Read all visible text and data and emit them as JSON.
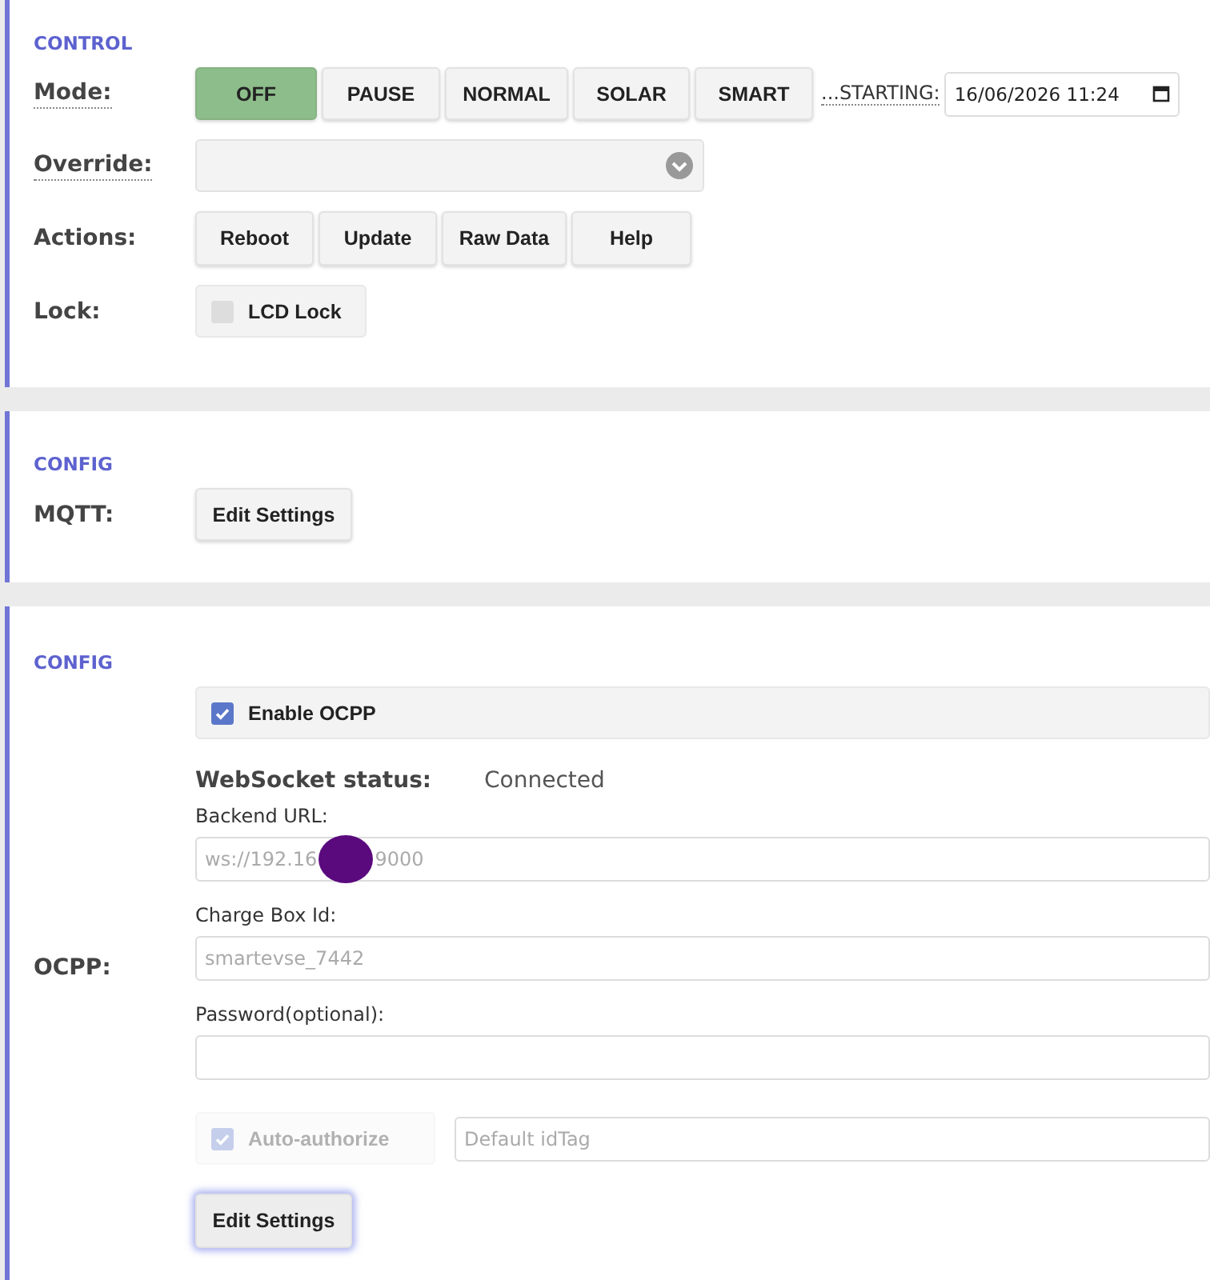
{
  "control": {
    "heading": "CONTROL",
    "mode": {
      "label": "Mode:",
      "buttons": [
        {
          "label": "OFF",
          "selected": true
        },
        {
          "label": "PAUSE",
          "selected": false
        },
        {
          "label": "NORMAL",
          "selected": false
        },
        {
          "label": "SOLAR",
          "selected": false
        },
        {
          "label": "SMART",
          "selected": false
        }
      ],
      "starting_label": "...STARTING:",
      "starting_value": "16/06/2026 11:24"
    },
    "override": {
      "label": "Override:"
    },
    "actions": {
      "label": "Actions:",
      "buttons": [
        "Reboot",
        "Update",
        "Raw Data",
        "Help"
      ]
    },
    "lock": {
      "label": "Lock:",
      "checkbox": {
        "label": "LCD Lock",
        "checked": false
      }
    }
  },
  "mqtt": {
    "heading": "CONFIG",
    "label": "MQTT:",
    "button": "Edit Settings"
  },
  "ocpp": {
    "heading": "CONFIG",
    "label": "OCPP:",
    "enable": {
      "label": "Enable OCPP",
      "checked": true
    },
    "status_label": "WebSocket status:",
    "status_value": "Connected",
    "backend_url": {
      "label": "Backend URL:",
      "value_start": "ws://192.16",
      "value_end": "9000",
      "redacted": true
    },
    "charge_box_id": {
      "label": "Charge Box Id:",
      "placeholder": "smartevse_7442"
    },
    "password": {
      "label": "Password(optional):"
    },
    "auto_authorize": {
      "label": "Auto-authorize",
      "checked": true,
      "disabled": true
    },
    "id_tag": {
      "placeholder": "Default idTag"
    },
    "button": {
      "label": "Edit Settings",
      "focused": true
    }
  }
}
